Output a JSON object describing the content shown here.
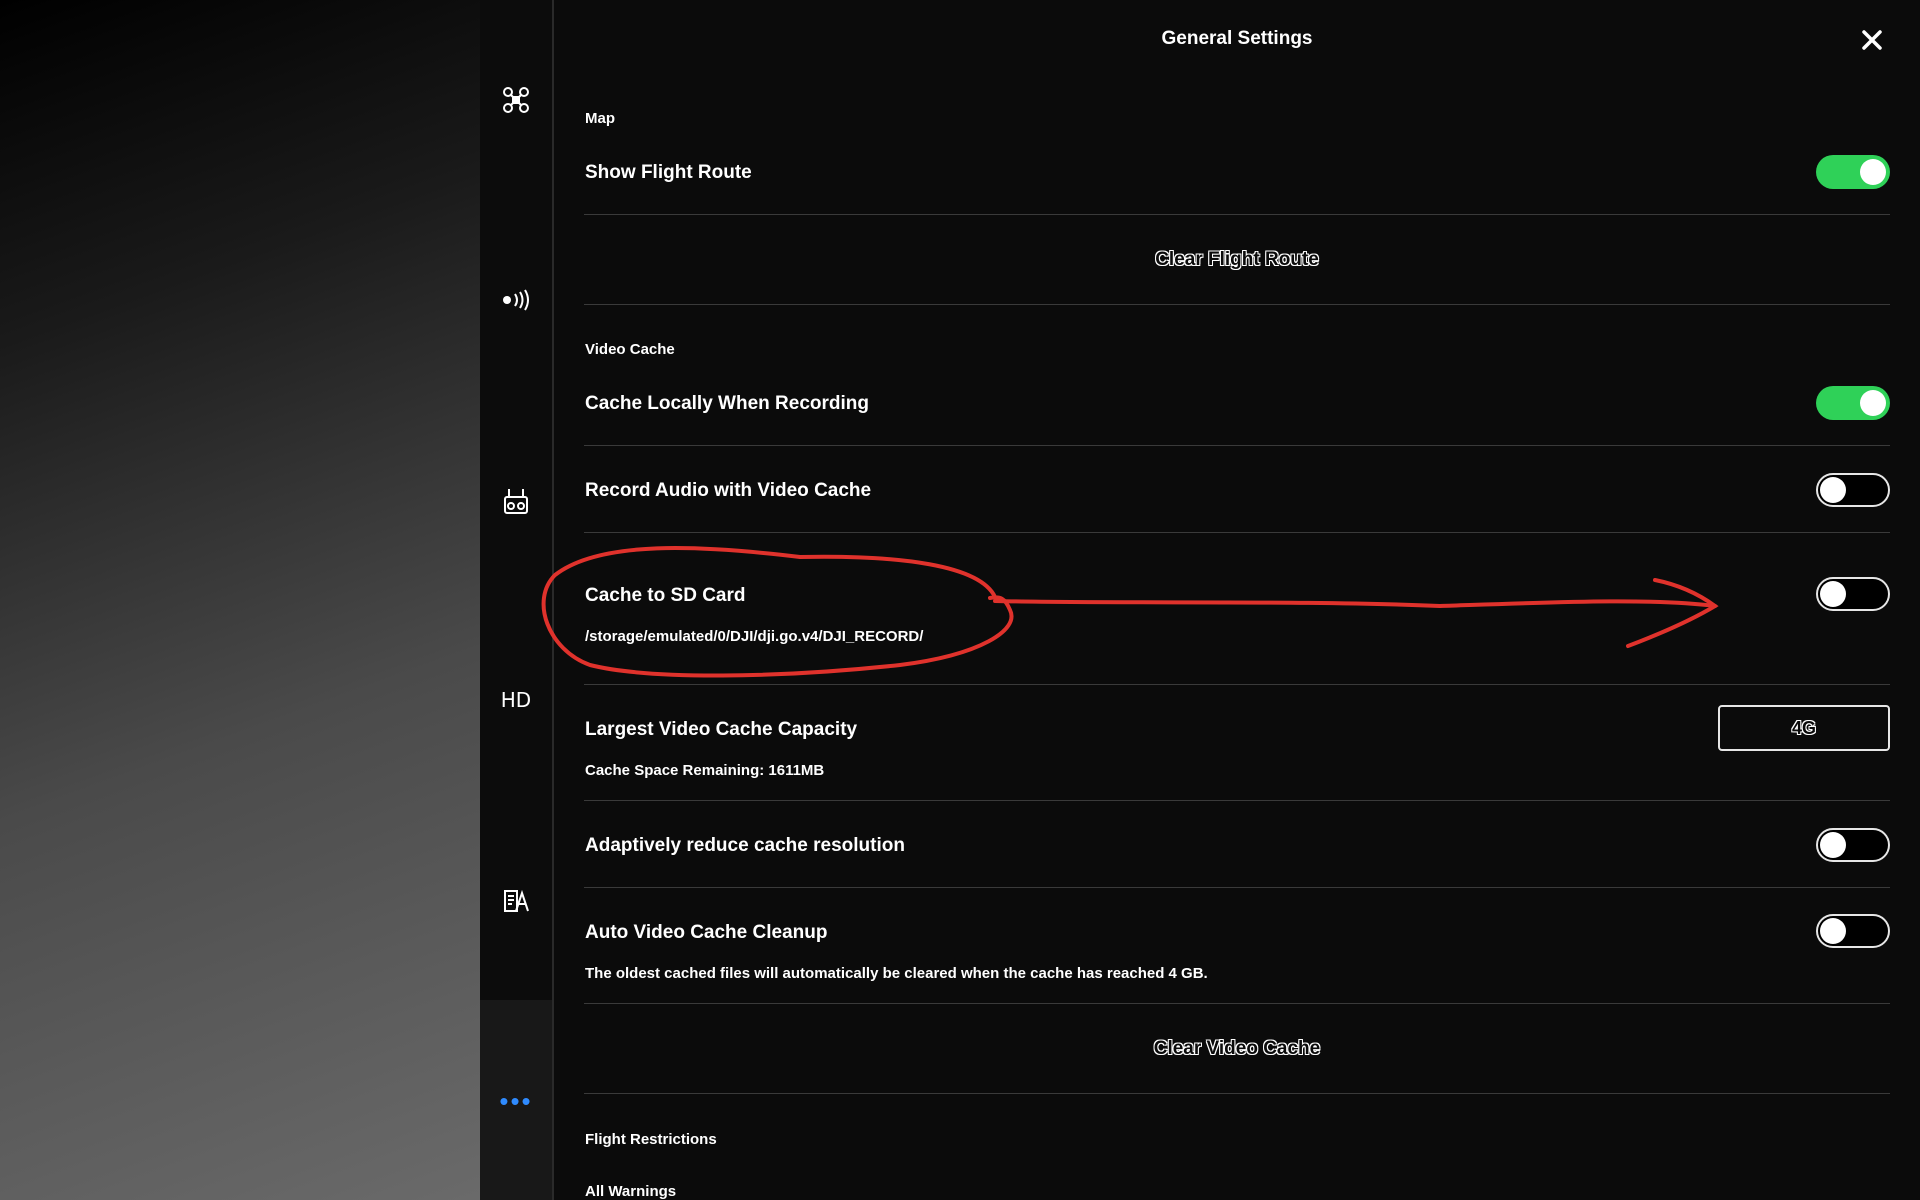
{
  "panel": {
    "title": "General Settings",
    "close_icon": "close-icon"
  },
  "sidebar": {
    "icons": [
      "aircraft-icon",
      "signal-icon",
      "remote-controller-icon",
      "hd-icon",
      "map-style-icon",
      "more-icon"
    ],
    "hd_label": "HD",
    "more_label": "•••",
    "active_color": "#2f8bff"
  },
  "sections": {
    "map": {
      "label": "Map",
      "show_flight_route": {
        "label": "Show Flight Route",
        "enabled": true
      },
      "clear_flight_route_label": "Clear Flight Route"
    },
    "video_cache": {
      "label": "Video Cache",
      "cache_locally": {
        "label": "Cache Locally When Recording",
        "enabled": true
      },
      "record_audio": {
        "label": "Record Audio with Video Cache",
        "enabled": false
      },
      "cache_to_sd": {
        "label": "Cache to SD Card",
        "path": "/storage/emulated/0/DJI/dji.go.v4/DJI_RECORD/",
        "enabled": false
      },
      "largest_capacity": {
        "label": "Largest Video Cache Capacity",
        "value": "4G",
        "remaining": "Cache Space Remaining: 1611MB"
      },
      "adaptive_resolution": {
        "label": "Adaptively reduce cache resolution",
        "enabled": false
      },
      "auto_cleanup": {
        "label": "Auto Video Cache Cleanup",
        "description": "The oldest cached files will automatically be cleared when the cache has reached 4 GB.",
        "enabled": false
      },
      "clear_video_cache_label": "Clear Video Cache"
    },
    "flight_restrictions": {
      "label": "Flight Restrictions",
      "all_warnings_label": "All Warnings"
    }
  },
  "colors": {
    "toggle_on": "#2fd158",
    "annotation": "#e0322c"
  }
}
